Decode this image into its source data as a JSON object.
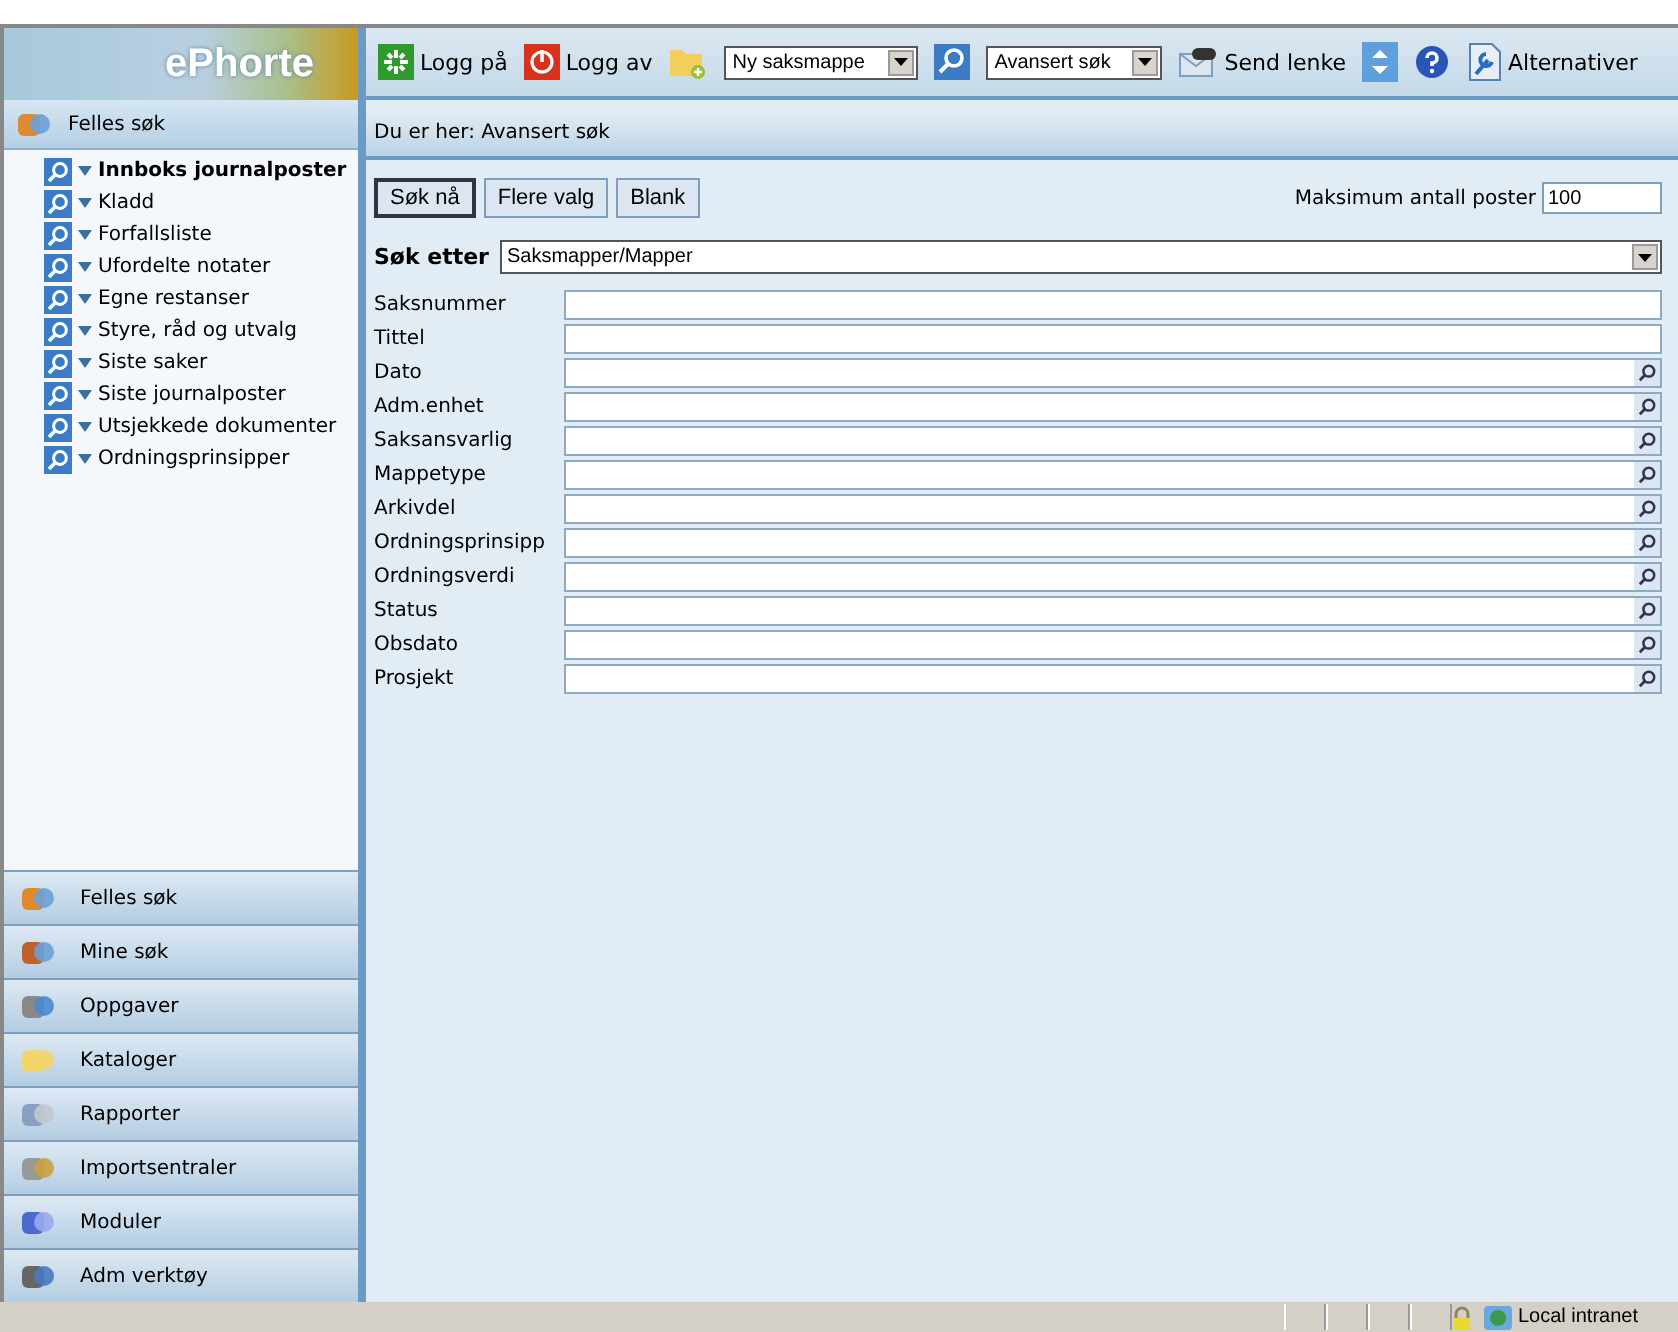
{
  "app_title": "ePhorte",
  "toolbar": [
    {
      "kind": "button",
      "label": "Logg på"
    },
    {
      "kind": "button",
      "label": "Logg av"
    },
    {
      "kind": "icon"
    },
    {
      "kind": "select",
      "value": "Ny saksmappe"
    },
    {
      "kind": "icon"
    },
    {
      "kind": "select",
      "value": "Avansert søk"
    },
    {
      "kind": "button",
      "label": "Send lenke"
    },
    {
      "kind": "icon"
    },
    {
      "kind": "icon"
    },
    {
      "kind": "button",
      "label": "Alternativer"
    }
  ],
  "sidebar": {
    "section": "Felles søk",
    "items": [
      {
        "label": "Innboks journalposter",
        "selected": true
      },
      {
        "label": "Kladd",
        "selected": false
      },
      {
        "label": "Forfallsliste",
        "selected": false
      },
      {
        "label": "Ufordelte notater",
        "selected": false
      },
      {
        "label": "Egne restanser",
        "selected": false
      },
      {
        "label": "Styre, råd og utvalg",
        "selected": false
      },
      {
        "label": "Siste saker",
        "selected": false
      },
      {
        "label": "Siste journalposter",
        "selected": false
      },
      {
        "label": "Utsjekkede dokumenter",
        "selected": false
      },
      {
        "label": "Ordningsprinsipper",
        "selected": false
      }
    ],
    "nav": [
      "Felles søk",
      "Mine søk",
      "Oppgaver",
      "Kataloger",
      "Rapporter",
      "Importsentraler",
      "Moduler",
      "Adm verktøy"
    ]
  },
  "breadcrumb": "Du er her: Avansert søk",
  "actions": [
    {
      "label": "Søk nå",
      "selected": true
    },
    {
      "label": "Flere valg",
      "selected": false
    },
    {
      "label": "Blank",
      "selected": false
    }
  ],
  "max_records": {
    "label": "Maksimum antall poster",
    "value": "100"
  },
  "search_for": {
    "label": "Søk etter",
    "value": "Saksmapper/Mapper"
  },
  "fields": [
    {
      "label": "Saksnummer",
      "kind": "text"
    },
    {
      "label": "Tittel",
      "kind": "text"
    },
    {
      "label": "Dato",
      "kind": "lookup"
    },
    {
      "label": "Adm.enhet",
      "kind": "lookup"
    },
    {
      "label": "Saksansvarlig",
      "kind": "lookup"
    },
    {
      "label": "Mappetype",
      "kind": "lookup"
    },
    {
      "label": "Arkivdel",
      "kind": "lookup"
    },
    {
      "label": "Ordningsprinsipp",
      "kind": "lookup"
    },
    {
      "label": "Ordningsverdi",
      "kind": "lookup"
    },
    {
      "label": "Status",
      "kind": "lookup"
    },
    {
      "label": "Obsdato",
      "kind": "lookup"
    },
    {
      "label": "Prosjekt",
      "kind": "lookup"
    }
  ],
  "status_bar": {
    "zone": "Local intranet"
  }
}
